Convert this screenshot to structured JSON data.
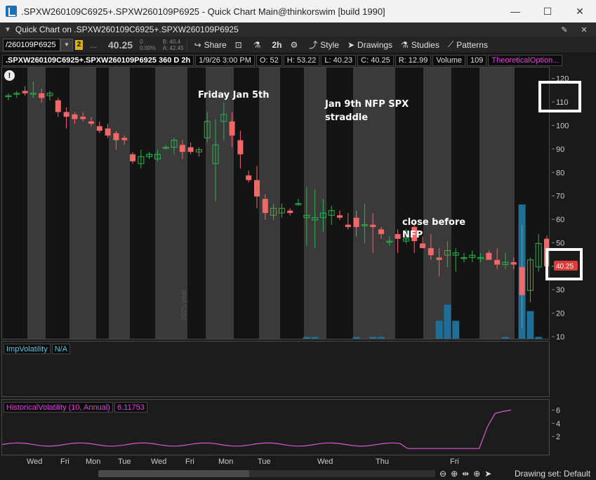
{
  "window": {
    "title": ".SPXW260109C6925+.SPXW260109P6925 - Quick Chart Main@thinkorswim [build 1990]",
    "minimize": "—",
    "maximize": "☐",
    "close": "✕"
  },
  "quick_chart": {
    "title": "Quick Chart on .SPXW260109C6925+.SPXW260109P6925",
    "pin_icon": "✎",
    "close_icon": "✕"
  },
  "toolbar": {
    "symbol_value": "/260109P6925",
    "link_badge": "2",
    "more": "...",
    "last": "40.25",
    "net_change": "0",
    "pct_change": "0.00%",
    "bid": "B: 40.4",
    "ask": "A: 42.45",
    "timeframe": "2h",
    "share": "Share",
    "style": "Style",
    "drawings": "Drawings",
    "studies": "Studies",
    "patterns": "Patterns"
  },
  "info": {
    "symbol": ".SPXW260109C6925+.SPXW260109P6925 360 D 2h",
    "datetime": "1/9/26 3:00 PM",
    "open": "O: 52",
    "high": "H: 53.22",
    "low": "L: 40.23",
    "close": "C: 40.25",
    "range": "R: 12.99",
    "volume_label": "Volume",
    "volume": "109",
    "theo": "TheoreticalOption..."
  },
  "annotations": {
    "friday": "Friday Jan 5th",
    "nfp_line1": "Jan 9th NFP SPX",
    "nfp_line2": "straddle",
    "close_line1": "close before",
    "close_line2": "NFP",
    "alert": "!",
    "year_watermark": "2025 year"
  },
  "price_axis": {
    "ticks": [
      "120",
      "110",
      "100",
      "90",
      "80",
      "70",
      "60",
      "50",
      "40",
      "30",
      "20",
      "10"
    ],
    "last_price_badge": "40.25"
  },
  "iv_panel": {
    "label": "ImpVolatility",
    "value": "N/A"
  },
  "hv_panel": {
    "label": "HistoricalVolatility (10, Annual)",
    "value": "6.11753",
    "ticks": [
      "6",
      "4",
      "2"
    ]
  },
  "time_axis": {
    "days": [
      "Wed",
      "Fri",
      "Mon",
      "Tue",
      "Wed",
      "Fri",
      "Mon",
      "Tue",
      "Wed",
      "Thu",
      "Fri"
    ]
  },
  "bottom": {
    "drawing_set": "Drawing set: Default"
  },
  "colors": {
    "up": "#2bb24c",
    "down": "#f26868",
    "volume": "#1e6e96",
    "hv_line": "#d857d8",
    "session_dark": "#141414",
    "session_light": "#3a3a3a"
  },
  "chart_data": {
    "type": "candlestick",
    "ylim": [
      10,
      122
    ],
    "candles": [
      {
        "o": 113,
        "h": 114,
        "l": 111,
        "c": 113
      },
      {
        "o": 114,
        "h": 115,
        "l": 112,
        "c": 114
      },
      {
        "o": 115,
        "h": 117,
        "l": 113,
        "c": 114
      },
      {
        "o": 114,
        "h": 119,
        "l": 112,
        "c": 114
      },
      {
        "o": 114,
        "h": 116,
        "l": 110,
        "c": 112
      },
      {
        "o": 113,
        "h": 115,
        "l": 111,
        "c": 114
      },
      {
        "o": 111,
        "h": 112,
        "l": 104,
        "c": 106
      },
      {
        "o": 106,
        "h": 108,
        "l": 99,
        "c": 104
      },
      {
        "o": 105,
        "h": 106,
        "l": 101,
        "c": 103
      },
      {
        "o": 104,
        "h": 106,
        "l": 102,
        "c": 103
      },
      {
        "o": 102,
        "h": 104,
        "l": 100,
        "c": 101
      },
      {
        "o": 100,
        "h": 102,
        "l": 97,
        "c": 98
      },
      {
        "o": 99,
        "h": 101,
        "l": 95,
        "c": 96
      },
      {
        "o": 97,
        "h": 98,
        "l": 90,
        "c": 94
      },
      {
        "o": 95,
        "h": 96,
        "l": 92,
        "c": 94
      },
      {
        "o": 88,
        "h": 89,
        "l": 84,
        "c": 85
      },
      {
        "o": 84,
        "h": 90,
        "l": 82,
        "c": 87
      },
      {
        "o": 87,
        "h": 89,
        "l": 86,
        "c": 88
      },
      {
        "o": 86,
        "h": 90,
        "l": 85,
        "c": 88
      },
      {
        "o": 91,
        "h": 92,
        "l": 90,
        "c": 91
      },
      {
        "o": 91,
        "h": 95,
        "l": 88,
        "c": 94
      },
      {
        "o": 92,
        "h": 94,
        "l": 86,
        "c": 89
      },
      {
        "o": 91,
        "h": 93,
        "l": 88,
        "c": 89
      },
      {
        "o": 89,
        "h": 91,
        "l": 87,
        "c": 90
      },
      {
        "o": 95,
        "h": 106,
        "l": 93,
        "c": 102
      },
      {
        "o": 84,
        "h": 103,
        "l": 68,
        "c": 92
      },
      {
        "o": 102,
        "h": 110,
        "l": 94,
        "c": 105
      },
      {
        "o": 102,
        "h": 106,
        "l": 91,
        "c": 96
      },
      {
        "o": 94,
        "h": 98,
        "l": 82,
        "c": 88
      },
      {
        "o": 79,
        "h": 81,
        "l": 76,
        "c": 77
      },
      {
        "o": 77,
        "h": 83,
        "l": 65,
        "c": 70
      },
      {
        "o": 69,
        "h": 71,
        "l": 60,
        "c": 63
      },
      {
        "o": 62,
        "h": 67,
        "l": 60,
        "c": 65
      },
      {
        "o": 63,
        "h": 67,
        "l": 61,
        "c": 65
      },
      {
        "o": 64,
        "h": 65,
        "l": 62,
        "c": 63
      },
      {
        "o": 67,
        "h": 69,
        "l": 66,
        "c": 67
      },
      {
        "o": 61,
        "h": 74,
        "l": 49,
        "c": 62
      },
      {
        "o": 60,
        "h": 73,
        "l": 48,
        "c": 61
      },
      {
        "o": 61,
        "h": 69,
        "l": 55,
        "c": 63
      },
      {
        "o": 62,
        "h": 66,
        "l": 58,
        "c": 64
      },
      {
        "o": 62,
        "h": 64,
        "l": 60,
        "c": 61
      },
      {
        "o": 58,
        "h": 63,
        "l": 56,
        "c": 57
      },
      {
        "o": 61,
        "h": 64,
        "l": 53,
        "c": 57
      },
      {
        "o": 58,
        "h": 67,
        "l": 50,
        "c": 58
      },
      {
        "o": 58,
        "h": 63,
        "l": 46,
        "c": 57
      },
      {
        "o": 56,
        "h": 57,
        "l": 52,
        "c": 54
      },
      {
        "o": 51,
        "h": 53,
        "l": 49,
        "c": 51
      },
      {
        "o": 54,
        "h": 56,
        "l": 46,
        "c": 52
      },
      {
        "o": 51,
        "h": 56,
        "l": 50,
        "c": 52
      },
      {
        "o": 57,
        "h": 59,
        "l": 46,
        "c": 51
      },
      {
        "o": 50,
        "h": 53,
        "l": 48,
        "c": 48
      },
      {
        "o": 48,
        "h": 54,
        "l": 43,
        "c": 45
      },
      {
        "o": 44,
        "h": 48,
        "l": 36,
        "c": 43
      },
      {
        "o": 45,
        "h": 51,
        "l": 40,
        "c": 47
      },
      {
        "o": 45,
        "h": 48,
        "l": 38,
        "c": 46
      },
      {
        "o": 44,
        "h": 46,
        "l": 42,
        "c": 44
      },
      {
        "o": 44,
        "h": 47,
        "l": 42,
        "c": 45
      },
      {
        "o": 44,
        "h": 46,
        "l": 42,
        "c": 44
      },
      {
        "o": 46,
        "h": 47,
        "l": 43,
        "c": 43
      },
      {
        "o": 43,
        "h": 48,
        "l": 39,
        "c": 41
      },
      {
        "o": 41,
        "h": 46,
        "l": 39,
        "c": 42
      },
      {
        "o": 42,
        "h": 44,
        "l": 39,
        "c": 41
      },
      {
        "o": 40,
        "h": 58,
        "l": 14,
        "c": 28
      },
      {
        "o": 30,
        "h": 44,
        "l": 25,
        "c": 43
      },
      {
        "o": 40,
        "h": 54,
        "l": 38,
        "c": 50
      },
      {
        "o": 52,
        "h": 53.22,
        "l": 40.23,
        "c": 40.25
      }
    ],
    "volume": [
      0,
      0,
      0,
      0,
      0,
      0,
      0,
      0,
      0,
      0,
      0,
      0,
      0,
      0,
      0,
      0,
      0,
      0,
      0,
      0,
      0,
      0,
      0,
      0,
      0,
      0,
      0,
      0,
      0,
      0,
      0,
      0,
      0,
      0,
      0,
      0,
      1,
      1,
      0,
      0,
      0,
      0,
      1,
      0,
      1,
      1,
      0,
      0,
      0,
      0,
      0,
      0,
      6,
      11,
      6,
      0,
      0,
      0,
      0,
      0,
      1,
      0,
      42,
      9,
      1,
      0
    ]
  }
}
